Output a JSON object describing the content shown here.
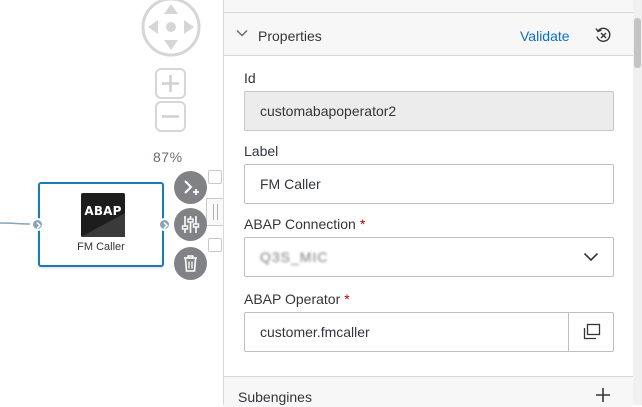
{
  "canvas": {
    "zoom_level": "87%",
    "node": {
      "icon_text": "ABAP",
      "label": "FM Caller"
    },
    "icons": {
      "navigation": "navigation-pad-icon",
      "zoom_in": "zoom-in-icon",
      "zoom_out": "zoom-out-icon",
      "connect": "connect-icon",
      "configure": "configure-icon",
      "delete": "delete-icon"
    }
  },
  "properties": {
    "title": "Properties",
    "validate_label": "Validate",
    "fields": {
      "id": {
        "label": "Id",
        "value": "customabapoperator2"
      },
      "label": {
        "label": "Label",
        "value": "FM Caller"
      },
      "connection": {
        "label": "ABAP Connection",
        "required": "*",
        "value": "Q3S_MIC"
      },
      "operator": {
        "label": "ABAP Operator",
        "required": "*",
        "value": "customer.fmcaller"
      }
    },
    "subengines_title": "Subengines"
  },
  "colors": {
    "accent": "#0a6ed1",
    "node_border": "#1a7bb9",
    "required": "#bb0000"
  }
}
